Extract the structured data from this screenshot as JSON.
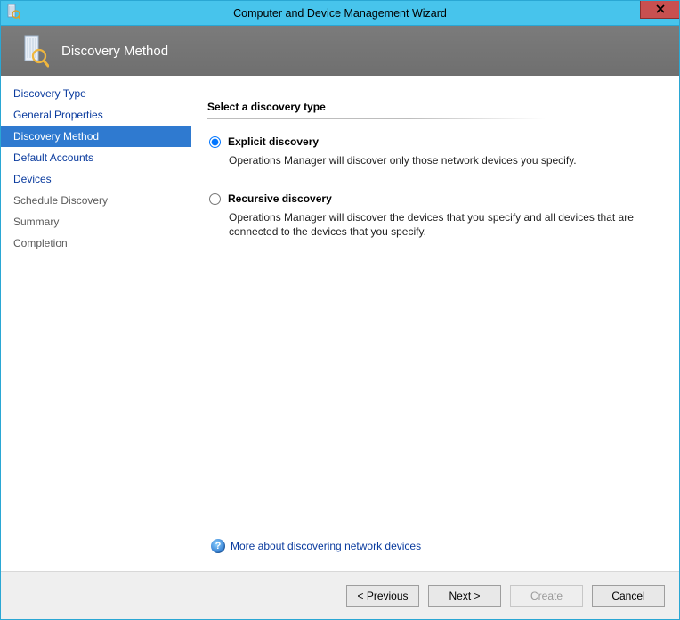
{
  "window": {
    "title": "Computer and Device Management Wizard"
  },
  "header": {
    "title": "Discovery Method"
  },
  "sidebar": {
    "items": [
      {
        "label": "Discovery Type",
        "state": "link"
      },
      {
        "label": "General Properties",
        "state": "link"
      },
      {
        "label": "Discovery Method",
        "state": "active"
      },
      {
        "label": "Default Accounts",
        "state": "link"
      },
      {
        "label": "Devices",
        "state": "link"
      },
      {
        "label": "Schedule Discovery",
        "state": "muted"
      },
      {
        "label": "Summary",
        "state": "muted"
      },
      {
        "label": "Completion",
        "state": "muted"
      }
    ]
  },
  "content": {
    "section_title": "Select a discovery type",
    "options": [
      {
        "id": "explicit",
        "label": "Explicit discovery",
        "description": "Operations Manager will discover only those network devices you specify.",
        "selected": true
      },
      {
        "id": "recursive",
        "label": "Recursive discovery",
        "description": "Operations Manager will discover the devices that you specify and all devices that are connected to the devices that you specify.",
        "selected": false
      }
    ],
    "help_link": "More about discovering network devices"
  },
  "footer": {
    "previous": "< Previous",
    "next": "Next >",
    "create": "Create",
    "cancel": "Cancel"
  }
}
